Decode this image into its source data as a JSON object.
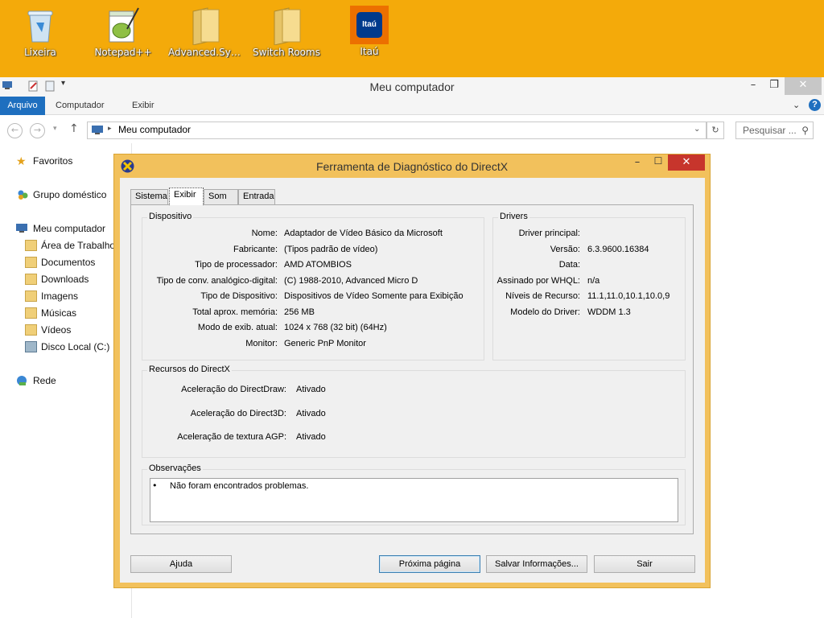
{
  "desktop": {
    "icons": [
      {
        "label": "Lixeira",
        "icon": "recycle-bin-icon"
      },
      {
        "label": "Notepad++",
        "icon": "notepadpp-icon"
      },
      {
        "label": "Advanced.Syste...",
        "icon": "folder-icon"
      },
      {
        "label": "Switch Rooms",
        "icon": "folder-icon"
      },
      {
        "label": "Itaú",
        "icon": "itau-logo-icon"
      }
    ]
  },
  "explorer": {
    "title": "Meu computador",
    "ribbon_tabs": [
      "Arquivo",
      "Computador",
      "Exibir"
    ],
    "address": "Meu computador",
    "search_placeholder": "Pesquisar ...",
    "nav": {
      "favoritos": "Favoritos",
      "grupo": "Grupo doméstico",
      "computer": "Meu computador",
      "items": [
        "Área de Trabalho",
        "Documentos",
        "Downloads",
        "Imagens",
        "Músicas",
        "Vídeos",
        "Disco Local (C:)"
      ],
      "rede": "Rede"
    }
  },
  "dxdiag": {
    "title": "Ferramenta de Diagnóstico do DirectX",
    "tabs": [
      "Sistema",
      "Exibir",
      "Som",
      "Entrada"
    ],
    "active_tab": "Exibir",
    "device": {
      "group_title": "Dispositivo",
      "rows": [
        {
          "key": "Nome:",
          "value": "Adaptador de Vídeo Básico da Microsoft"
        },
        {
          "key": "Fabricante:",
          "value": "(Tipos padrão de vídeo)"
        },
        {
          "key": "Tipo de processador:",
          "value": "AMD ATOMBIOS"
        },
        {
          "key": "Tipo de conv. analógico-digital:",
          "value": "(C) 1988-2010, Advanced Micro D"
        },
        {
          "key": "Tipo de Dispositivo:",
          "value": "Dispositivos de Vídeo Somente para Exibição"
        },
        {
          "key": "Total aprox. memória:",
          "value": "256 MB"
        },
        {
          "key": "Modo de exib. atual:",
          "value": "1024 x 768 (32 bit) (64Hz)"
        },
        {
          "key": "Monitor:",
          "value": "Generic PnP Monitor"
        }
      ]
    },
    "drivers": {
      "group_title": "Drivers",
      "rows": [
        {
          "key": "Driver principal:",
          "value": ""
        },
        {
          "key": "Versão:",
          "value": "6.3.9600.16384"
        },
        {
          "key": "Data:",
          "value": ""
        },
        {
          "key": "Assinado por WHQL:",
          "value": "n/a"
        },
        {
          "key": "Níveis de Recurso:",
          "value": "11.1,11.0,10.1,10.0,9"
        },
        {
          "key": "Modelo do Driver:",
          "value": "WDDM 1.3"
        }
      ]
    },
    "directx": {
      "group_title": "Recursos do DirectX",
      "rows": [
        {
          "key": "Aceleração do DirectDraw:",
          "value": "Ativado"
        },
        {
          "key": "Aceleração do Direct3D:",
          "value": "Ativado"
        },
        {
          "key": "Aceleração de textura AGP:",
          "value": "Ativado"
        }
      ]
    },
    "notes": {
      "group_title": "Observações",
      "items": [
        "Não foram encontrados problemas."
      ]
    },
    "buttons": {
      "help": "Ajuda",
      "next": "Próxima página",
      "save": "Salvar Informações...",
      "exit": "Sair"
    }
  }
}
